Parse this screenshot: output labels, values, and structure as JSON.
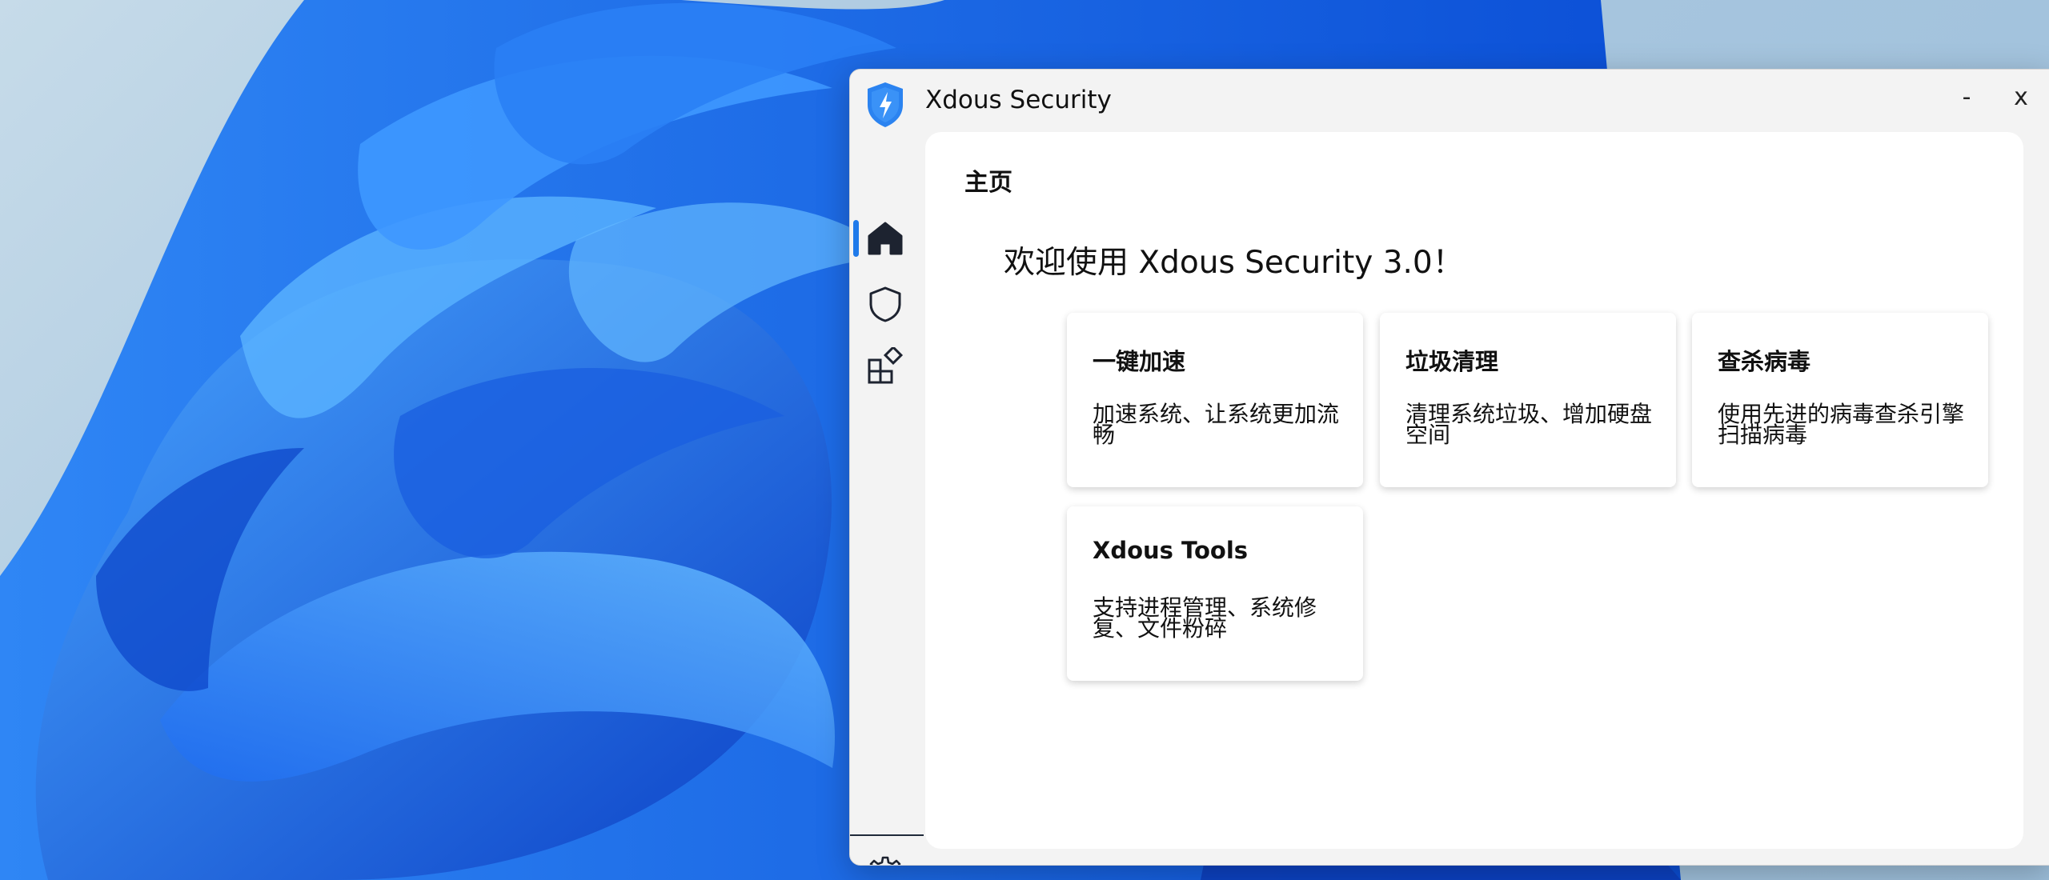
{
  "window": {
    "title": "Xdous Security",
    "minimize": "-",
    "close": "x"
  },
  "sidebar": {
    "items": [
      {
        "icon": "home-icon",
        "active": true
      },
      {
        "icon": "shield-icon",
        "active": false
      },
      {
        "icon": "apps-icon",
        "active": false
      },
      {
        "icon": "gear-icon",
        "active": false
      }
    ],
    "accent": "#1f7aea"
  },
  "page": {
    "title": "主页",
    "welcome": "欢迎使用 Xdous Security 3.0！"
  },
  "cards": [
    {
      "title": "一键加速",
      "desc": "加速系统、让系统更加流畅"
    },
    {
      "title": "垃圾清理",
      "desc": "清理系统垃圾、增加硬盘空间"
    },
    {
      "title": "查杀病毒",
      "desc": "使用先进的病毒查杀引擎扫描病毒"
    },
    {
      "title": "Xdous Tools",
      "desc": "支持进程管理、系统修复、文件粉碎"
    }
  ],
  "colors": {
    "logo": "#2b83f0",
    "content_bg": "#ffffff",
    "window_bg": "#f3f3f3"
  }
}
